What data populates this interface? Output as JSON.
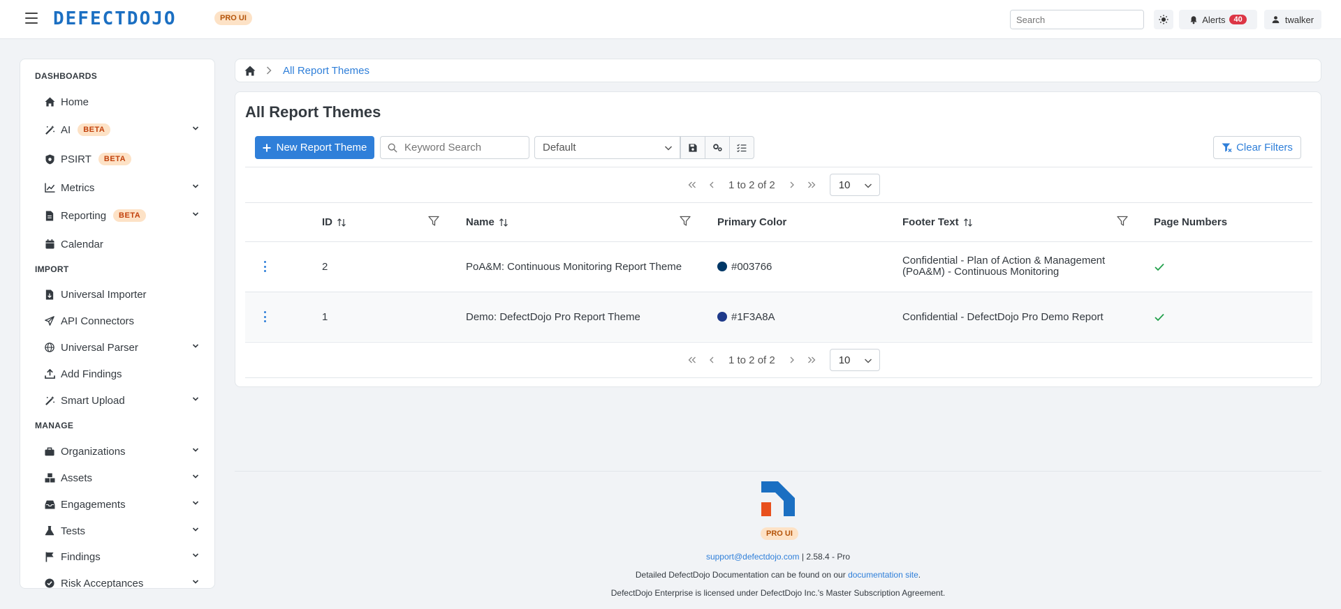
{
  "header": {
    "brand": "DEFECTDOJO",
    "pro_badge": "PRO UI",
    "search_placeholder": "Search",
    "alerts_label": "Alerts",
    "alerts_count": "40",
    "username": "twalker"
  },
  "sidebar": {
    "sections": {
      "dashboards": "DASHBOARDS",
      "import": "IMPORT",
      "manage": "MANAGE"
    },
    "items": {
      "home": "Home",
      "ai": "AI",
      "psirt": "PSIRT",
      "metrics": "Metrics",
      "reporting": "Reporting",
      "calendar": "Calendar",
      "universal_importer": "Universal Importer",
      "api_connectors": "API Connectors",
      "universal_parser": "Universal Parser",
      "add_findings": "Add Findings",
      "smart_upload": "Smart Upload",
      "organizations": "Organizations",
      "assets": "Assets",
      "engagements": "Engagements",
      "tests": "Tests",
      "findings": "Findings",
      "risk_acceptances": "Risk Acceptances"
    },
    "beta_label": "BETA"
  },
  "breadcrumb": {
    "current": "All Report Themes"
  },
  "main": {
    "title": "All Report Themes",
    "new_button": "New Report Theme",
    "keyword_placeholder": "Keyword Search",
    "preset_value": "Default",
    "clear_filters": "Clear Filters",
    "pagination": {
      "range_text": "1 to 2 of 2",
      "page_size": "10"
    },
    "table": {
      "headers": {
        "id": "ID",
        "name": "Name",
        "primary_color": "Primary Color",
        "footer_text": "Footer Text",
        "page_numbers": "Page Numbers"
      },
      "rows": [
        {
          "id": "2",
          "name": "PoA&M: Continuous Monitoring Report Theme",
          "primary_color": "#003766",
          "footer_line1": "Confidential - Plan of Action & Management",
          "footer_line2": "(PoA&M) - Continuous Monitoring",
          "page_numbers": true
        },
        {
          "id": "1",
          "name": "Demo: DefectDojo Pro Report Theme",
          "primary_color": "#1F3A8A",
          "footer_line1": "Confidential - DefectDojo Pro Demo Report",
          "footer_line2": "",
          "page_numbers": true
        }
      ]
    }
  },
  "footer": {
    "pro_label": "PRO UI",
    "support_email": "support@defectdojo.com",
    "version": "| 2.58.4 - Pro",
    "docs_prefix": "Detailed DefectDojo Documentation can be found on our",
    "docs_link": "documentation site",
    "docs_suffix": ".",
    "license": "DefectDojo Enterprise is licensed under DefectDojo Inc.'s Master Subscription Agreement."
  },
  "colors": {
    "accent": "#2f7fd9",
    "beta_bg": "#fde2c6",
    "alert_badge": "#dc3545",
    "check": "#22a04b"
  }
}
